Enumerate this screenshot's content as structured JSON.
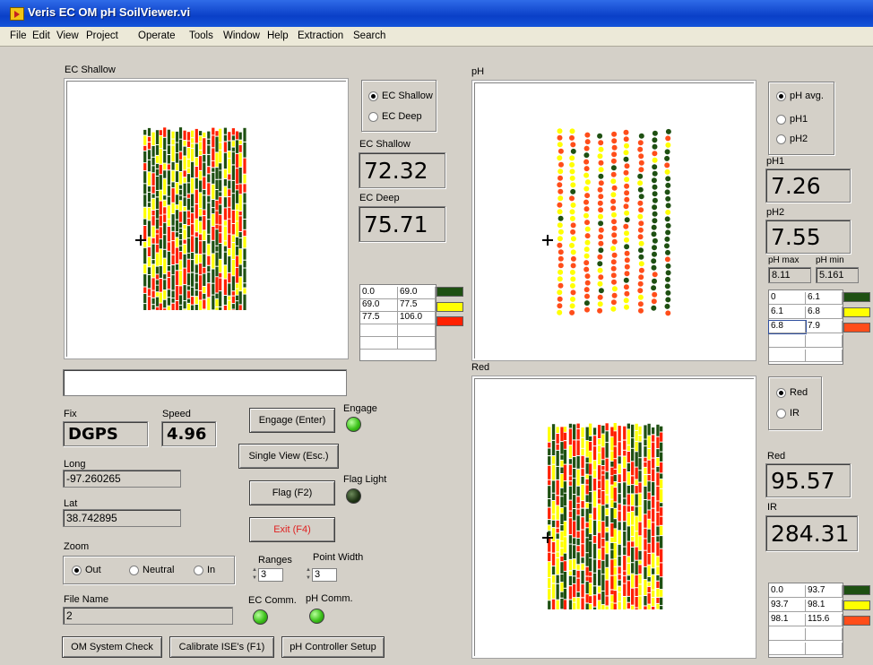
{
  "window": {
    "title": "Veris EC OM pH SoilViewer.vi"
  },
  "menu": [
    "File",
    "Edit",
    "View",
    "Project",
    "Operate",
    "Tools",
    "Window",
    "Help",
    "Extraction",
    "Search"
  ],
  "ec": {
    "plot_label": "EC Shallow",
    "radio": [
      "EC Shallow",
      "EC Deep"
    ],
    "radio_selected": 0,
    "shallow_label": "EC Shallow",
    "shallow_value": "72.32",
    "deep_label": "EC Deep",
    "deep_value": "75.71",
    "ranges": [
      [
        "0.0",
        "69.0"
      ],
      [
        "69.0",
        "77.5"
      ],
      [
        "77.5",
        "106.0"
      ]
    ]
  },
  "ph": {
    "plot_label": "pH",
    "radio": [
      "pH avg.",
      "pH1",
      "pH2"
    ],
    "radio_selected": 0,
    "ph1_label": "pH1",
    "ph1_value": "7.26",
    "ph2_label": "pH2",
    "ph2_value": "7.55",
    "max_label": "pH max",
    "max_value": "8.11",
    "min_label": "pH min",
    "min_value": "5.161",
    "ranges": [
      [
        "0",
        "6.1"
      ],
      [
        "6.1",
        "6.8"
      ],
      [
        "6.8",
        "7.9"
      ]
    ]
  },
  "red": {
    "plot_label": "Red",
    "radio": [
      "Red",
      "IR"
    ],
    "radio_selected": 0,
    "red_label": "Red",
    "red_value": "95.57",
    "ir_label": "IR",
    "ir_value": "284.31",
    "ranges": [
      [
        "0.0",
        "93.7"
      ],
      [
        "93.7",
        "98.1"
      ],
      [
        "98.1",
        "115.6"
      ]
    ]
  },
  "colors": {
    "low": "#1e5012",
    "mid": "#ffff00",
    "high": "#ff2000",
    "high_alt": "#ff4d1a"
  },
  "gps": {
    "fix_label": "Fix",
    "fix_value": "DGPS",
    "speed_label": "Speed",
    "speed_value": "4.96",
    "long_label": "Long",
    "long_value": "-97.260265",
    "lat_label": "Lat",
    "lat_value": "38.742895"
  },
  "zoom": {
    "label": "Zoom",
    "options": [
      "Out",
      "Neutral",
      "In"
    ],
    "selected": 0
  },
  "file": {
    "label": "File Name",
    "value": "2"
  },
  "buttons": {
    "engage": "Engage (Enter)",
    "single_view": "Single View (Esc.)",
    "flag": "Flag (F2)",
    "exit": "Exit (F4)",
    "om_check": "OM System Check",
    "calibrate": "Calibrate ISE's (F1)",
    "ph_setup": "pH Controller Setup"
  },
  "indicators": {
    "engage_label": "Engage",
    "flag_label": "Flag Light",
    "ec_comm_label": "EC Comm.",
    "ph_comm_label": "pH Comm."
  },
  "ranges_ctrl": {
    "label": "Ranges",
    "value": "3"
  },
  "point_width": {
    "label": "Point Width",
    "value": "3"
  }
}
